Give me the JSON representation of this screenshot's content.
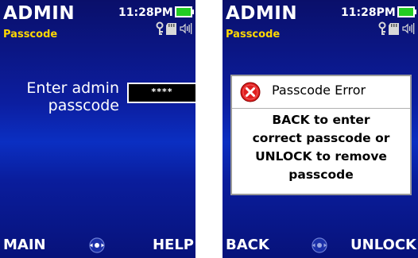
{
  "left_screen": {
    "title": "ADMIN",
    "subtitle": "Passcode",
    "clock": "11:28PM",
    "prompt_line1": "Enter admin",
    "prompt_line2": "passcode",
    "passcode_value": "****",
    "softkey_left": "MAIN",
    "softkey_right": "HELP"
  },
  "right_screen": {
    "title": "ADMIN",
    "subtitle": "Passcode",
    "clock": "11:28PM",
    "dialog": {
      "title": "Passcode Error",
      "lines": [
        "BACK to enter",
        "correct passcode or",
        "UNLOCK to remove",
        "passcode"
      ]
    },
    "softkey_left": "BACK",
    "softkey_right": "UNLOCK"
  },
  "icons": {
    "battery": "battery-icon",
    "key": "key-icon",
    "sd_card": "sd-card-icon",
    "speaker": "speaker-icon",
    "dpad": "dpad-icon",
    "error": "error-icon"
  },
  "colors": {
    "subtitle_yellow": "#ffd800",
    "battery_green": "#22cc22",
    "error_red": "#e02020",
    "screen_blue": "#0c1ea0"
  }
}
